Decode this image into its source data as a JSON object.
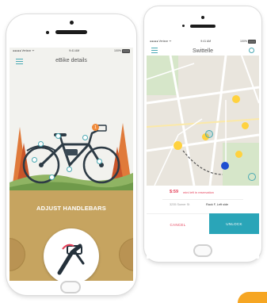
{
  "left_phone": {
    "status": {
      "carrier": "●●●●● Verizon ᯤ",
      "time": "9:41 AM",
      "battery_pct": "100%"
    },
    "header": {
      "title": "eBike details"
    },
    "hotspot_badge": "1",
    "action": {
      "label": "ADJUST HANDLEBARS"
    }
  },
  "right_phone": {
    "status": {
      "carrier": "●●●●● Verizon ᯤ",
      "time": "9:41 AM",
      "battery_pct": "100%"
    },
    "header": {
      "title": "Swittelle"
    },
    "reservation": {
      "price": "$:59",
      "minutes_text": "mini left in reservation"
    },
    "location": {
      "address": "3235 Sumer St",
      "rack": "Rack F, Left side"
    },
    "buttons": {
      "cancel": "CANCEL",
      "unlock": "UNLOCK"
    },
    "colors": {
      "accent": "#2aa5b8",
      "alert": "#e5415a",
      "pin": "#ffd23f",
      "bike_pin": "#1f4fd1"
    }
  }
}
